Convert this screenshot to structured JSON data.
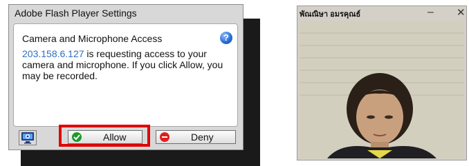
{
  "flash_dialog": {
    "title": "Adobe Flash Player Settings",
    "heading": "Camera and Microphone Access",
    "help_icon": "question-mark-icon",
    "ip": "203.158.6.127",
    "message": " is requesting access to your camera and microphone. If you click Allow, you may be recorded.",
    "allow_label": "Allow",
    "deny_label": "Deny",
    "highlight_color": "#e00000",
    "link_color": "#2f6ec0"
  },
  "webcam_window": {
    "title": "พัณณิษา อมรคุณธ์",
    "minimize_symbol": "–",
    "close_symbol": "✕"
  }
}
